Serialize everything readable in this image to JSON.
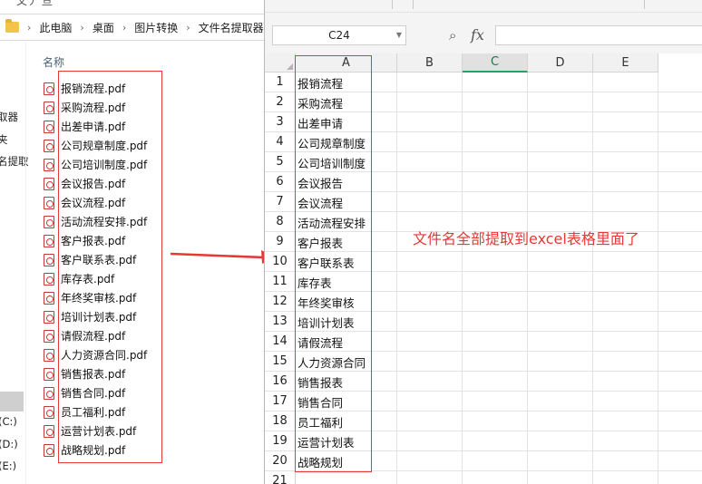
{
  "explorer": {
    "top_fragment": "文丿   亘       ",
    "breadcrumb": [
      "此电脑",
      "桌面",
      "图片转换",
      "文件名提取器"
    ],
    "nav_items": [
      "取器",
      "夹",
      "名提取",
      "(C:)",
      "(D:)",
      "(E:)"
    ],
    "column_header": "名称",
    "files": [
      "报销流程.pdf",
      "采购流程.pdf",
      "出差申请.pdf",
      "公司规章制度.pdf",
      "公司培训制度.pdf",
      "会议报告.pdf",
      "会议流程.pdf",
      "活动流程安排.pdf",
      "客户报表.pdf",
      "客户联系表.pdf",
      "库存表.pdf",
      "年终奖审核.pdf",
      "培训计划表.pdf",
      "请假流程.pdf",
      "人力资源合同.pdf",
      "销售报表.pdf",
      "销售合同.pdf",
      "员工福利.pdf",
      "运营计划表.pdf",
      "战略规划.pdf"
    ]
  },
  "sheet": {
    "name_box": "C24",
    "fx_label": "fx",
    "columns": [
      "A",
      "B",
      "C",
      "D",
      "E"
    ],
    "active_column": "C",
    "row_numbers": [
      "1",
      "2",
      "3",
      "4",
      "5",
      "6",
      "7",
      "8",
      "9",
      "10",
      "11",
      "12",
      "13",
      "14",
      "15",
      "16",
      "17",
      "18",
      "19",
      "20",
      "21"
    ],
    "column_a": [
      "报销流程",
      "采购流程",
      "出差申请",
      "公司规章制度",
      "公司培训制度",
      "会议报告",
      "会议流程",
      "活动流程安排",
      "客户报表",
      "客户联系表",
      "库存表",
      "年终奖审核",
      "培训计划表",
      "请假流程",
      "人力资源合同",
      "销售报表",
      "销售合同",
      "员工福利",
      "运营计划表",
      "战略规划"
    ],
    "annotation": "文件名全部提取到excel表格里面了"
  },
  "colors": {
    "highlight": "#e03c3c",
    "annotation": "#e53935",
    "active_col_accent": "#21a366"
  }
}
